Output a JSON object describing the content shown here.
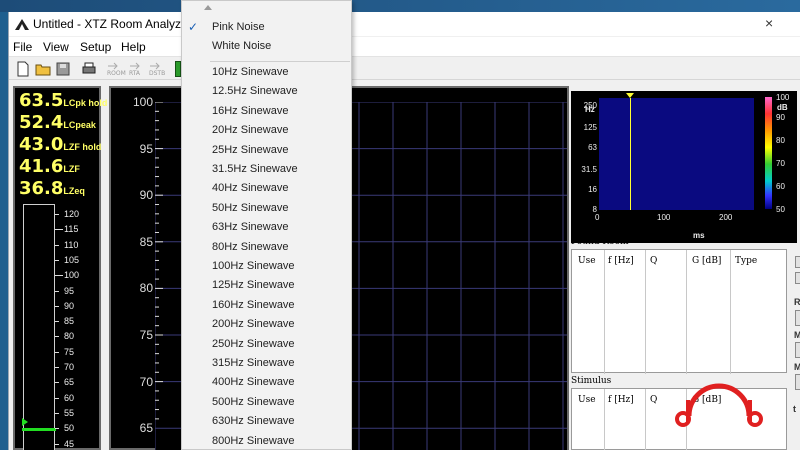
{
  "window": {
    "title": "Untitled - XTZ Room Analyzer",
    "close_glyph": "×"
  },
  "menubar": [
    "File",
    "View",
    "Setup",
    "Help"
  ],
  "toolbar": {
    "labels": [
      "ROOM",
      "RTA",
      "DSTB"
    ]
  },
  "level_meter": {
    "readouts": [
      {
        "value": "63.5",
        "unit": "LCpk hold"
      },
      {
        "value": "52.4",
        "unit": "LCpeak"
      },
      {
        "value": "43.0",
        "unit": "LZF hold"
      },
      {
        "value": "41.6",
        "unit": "LZF"
      },
      {
        "value": "36.8",
        "unit": "LZeq"
      }
    ],
    "scale": [
      "120",
      "115",
      "110",
      "105",
      "100",
      "95",
      "90",
      "85",
      "80",
      "75",
      "70",
      "65",
      "60",
      "55",
      "50",
      "45"
    ],
    "hold_level_db": 50,
    "bar_color": "#22dd22",
    "readout_color": "#ffff66"
  },
  "main_graph": {
    "y_labels": [
      "100",
      "95",
      "90",
      "85",
      "80",
      "75",
      "70",
      "65"
    ],
    "grid_color": "#3a3a78"
  },
  "spectrogram": {
    "y_labels": [
      "250",
      "125",
      "63",
      "31.5",
      "16",
      "8"
    ],
    "y_unit": "Hz",
    "x_labels": [
      "0",
      "100",
      "200"
    ],
    "x_unit": "ms",
    "cbar_labels": [
      "100",
      "90",
      "80",
      "70",
      "60",
      "50"
    ],
    "cbar_unit": "dB",
    "marker_ms": 50,
    "background": "#0a0a80",
    "marker_color": "#ffff33"
  },
  "found_room": {
    "label": "Found Room",
    "columns": [
      "Use",
      "f [Hz]",
      "Q",
      "G [dB]",
      "Type"
    ]
  },
  "stimulus": {
    "label": "Stimulus",
    "columns": [
      "Use",
      "f [Hz]",
      "Q",
      "G [dB]"
    ]
  },
  "side_controls": [
    "R",
    "M",
    "M",
    "t"
  ],
  "dropdown": {
    "selected": "Pink Noise",
    "top_items": [
      "Pink Noise",
      "White Noise"
    ],
    "items": [
      "10Hz Sinewave",
      "12.5Hz Sinewave",
      "16Hz Sinewave",
      "20Hz Sinewave",
      "25Hz Sinewave",
      "31.5Hz Sinewave",
      "40Hz Sinewave",
      "50Hz Sinewave",
      "63Hz Sinewave",
      "80Hz Sinewave",
      "100Hz Sinewave",
      "125Hz Sinewave",
      "160Hz Sinewave",
      "200Hz Sinewave",
      "250Hz Sinewave",
      "315Hz Sinewave",
      "400Hz Sinewave",
      "500Hz Sinewave",
      "630Hz Sinewave",
      "800Hz Sinewave"
    ],
    "check_glyph": "✓"
  },
  "colors": {
    "accent": "#1a5fb4",
    "watermark": "#e02020"
  }
}
